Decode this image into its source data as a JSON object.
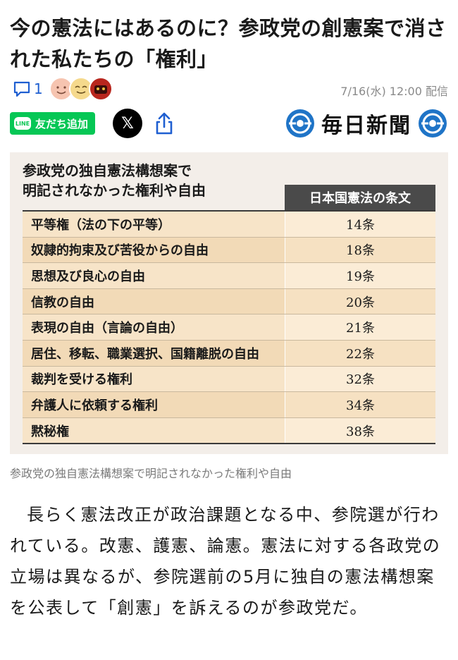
{
  "article": {
    "title": "今の憲法にはあるのに？参政党の創憲案で消された私たちの「権利」",
    "comment_count": "1",
    "date": "7/16(水) 12:00 配信"
  },
  "share": {
    "line_badge": "LINE",
    "line_label": "友だち追加",
    "x_label": "𝕏",
    "publisher": "毎日新聞"
  },
  "figure": {
    "heading_line1": "参政党の独自憲法構想案で",
    "heading_line2": "明記されなかった権利や自由",
    "column_header": "日本国憲法の条文",
    "rows": [
      {
        "name": "平等権（法の下の平等）",
        "article": "14条"
      },
      {
        "name": "奴隷的拘束及び苦役からの自由",
        "article": "18条"
      },
      {
        "name": "思想及び良心の自由",
        "article": "19条"
      },
      {
        "name": "信教の自由",
        "article": "20条"
      },
      {
        "name": "表現の自由（言論の自由）",
        "article": "21条"
      },
      {
        "name": "居住、移転、職業選択、国籍離脱の自由",
        "article": "22条"
      },
      {
        "name": "裁判を受ける権利",
        "article": "32条"
      },
      {
        "name": "弁護人に依頼する権利",
        "article": "34条"
      },
      {
        "name": "黙秘権",
        "article": "38条"
      }
    ],
    "caption": "参政党の独自憲法構想案で明記されなかった権利や自由"
  },
  "body": {
    "paragraph": "長らく憲法改正が政治課題となる中、参院選が行われている。改憲、護憲、論憲。憲法に対する各政党の立場は異なるが、参院選前の5月に独自の憲法構想案を公表して「創憲」を訴えるのが参政党だ。"
  },
  "colors": {
    "accent_blue": "#1f5fd1",
    "line_green": "#06c755",
    "table_row": "#f7e4c8",
    "header_dark": "#4a4a4a"
  }
}
